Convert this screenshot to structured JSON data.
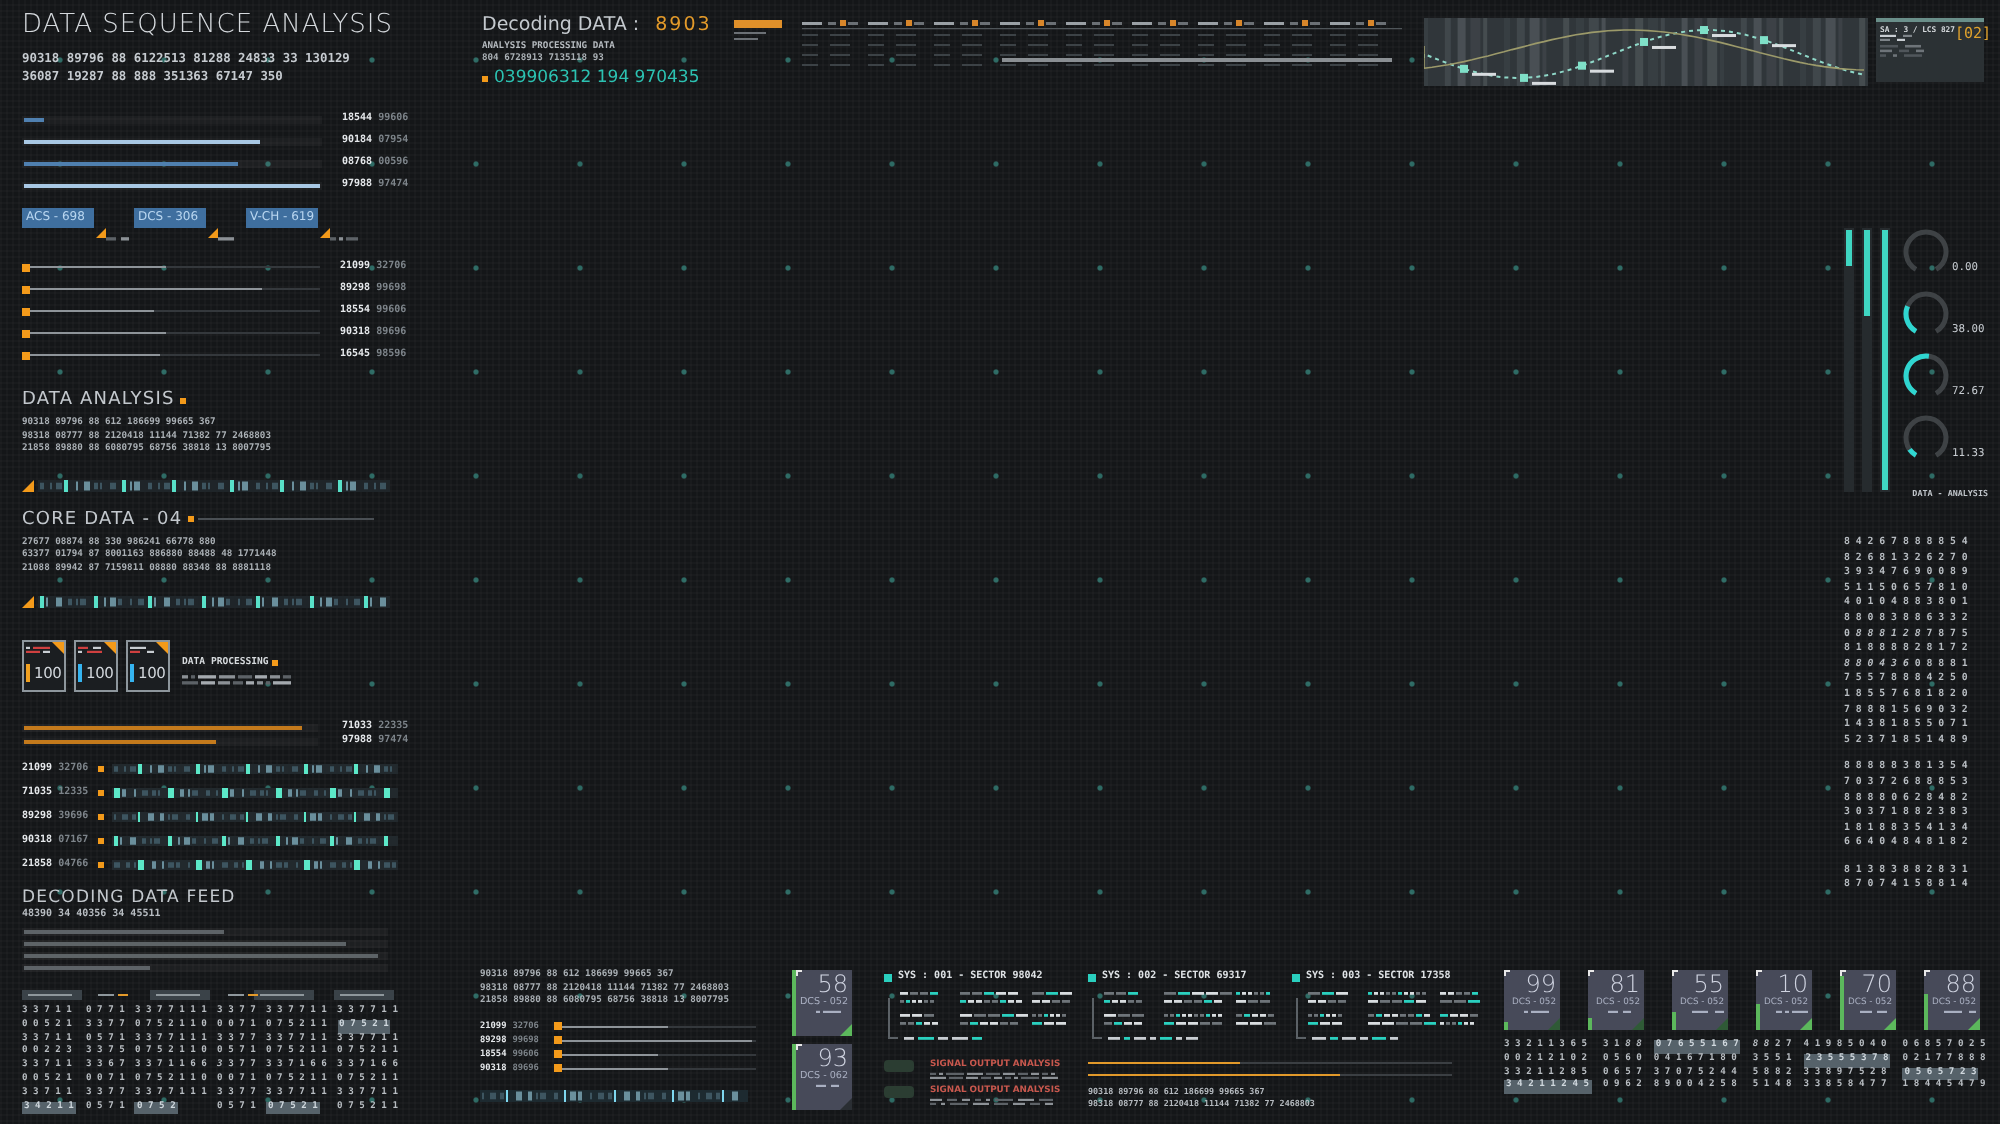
{
  "title": "DATA SEQUENCE ANALYSIS",
  "header_codes": [
    "90318 89796 88 6122513 81288 24833 33 130129",
    "36087 19287 88 888 351363 67147 350"
  ],
  "level_bars": [
    {
      "level": 0.07,
      "color": "#4f80b0",
      "value": "18544",
      "code": "99606"
    },
    {
      "level": 0.8,
      "color": "#a8c8e4",
      "value": "90184",
      "code": "07954"
    },
    {
      "level": 0.72,
      "color": "#4f80b0",
      "value": "08768",
      "code": "00596"
    },
    {
      "level": 1,
      "color": "#a8c8e4",
      "value": "97988",
      "code": "97474"
    }
  ],
  "tags": [
    "ACS - 698",
    "DCS - 306",
    "V-CH - 619"
  ],
  "sliders": [
    {
      "level": 0.47,
      "value": "21099",
      "code": "32706"
    },
    {
      "level": 0.8,
      "value": "89298",
      "code": "99698"
    },
    {
      "level": 0.43,
      "value": "18554",
      "code": "99606"
    },
    {
      "level": 0.47,
      "value": "90318",
      "code": "89696"
    },
    {
      "level": 0.45,
      "value": "16545",
      "code": "98596"
    }
  ],
  "data_analysis": {
    "title": "DATA ANALYSIS",
    "lines": [
      "90318 89796 88 612 186699 99665 367",
      "98318 08777 88 2120418 11144 71382 77 2468803",
      "21858 89880 88 6080795 68756 38818 13 8007795"
    ]
  },
  "core_data": {
    "title": "CORE DATA - 04",
    "lines": [
      "27677 08874 88 330 986241 66778 880",
      "63377 01794 87 8001163 886880 88488 48 1771448",
      "21088 89942 87 7159811 08880 88348 88 8881118"
    ]
  },
  "meters": [
    {
      "value": "100",
      "color": "#f0a020"
    },
    {
      "value": "100",
      "color": "#35b4f0"
    },
    {
      "value": "100",
      "color": "#35b4f0"
    }
  ],
  "processing": {
    "title": "DATA PROCESSING"
  },
  "orange_bars": [
    {
      "level": 0.95,
      "value": "71033",
      "code": "22335"
    },
    {
      "level": 0.66,
      "value": "97988",
      "code": "97474"
    }
  ],
  "signal_rows": [
    {
      "value": "21099",
      "code": "32706"
    },
    {
      "value": "71035",
      "code": "12335"
    },
    {
      "value": "89298",
      "code": "39696"
    },
    {
      "value": "90318",
      "code": "07167"
    },
    {
      "value": "21858",
      "code": "04766"
    }
  ],
  "feed": {
    "title": "DECODING DATA FEED",
    "code": "48390 34 40356 34 45511",
    "bars": [
      {
        "level": 0.55
      },
      {
        "level": 0.89
      },
      {
        "level": 0.98
      },
      {
        "level": 0.35
      }
    ]
  },
  "feed_grid": [
    {
      "rows": [
        {
          "text": "3 3 7 1 1",
          "framed": false
        },
        {
          "text": "0 0 5 2 1",
          "framed": false
        },
        {
          "text": "3 3 7 1 1",
          "framed": false
        },
        {
          "text": "0 0 2 2 3",
          "framed": false
        },
        {
          "text": "3 3 7 1 1",
          "framed": false
        },
        {
          "text": "0 0 5 2 1",
          "framed": false
        },
        {
          "text": "3 3 7 1 1",
          "framed": false
        },
        {
          "text": "3 4 2 1 1",
          "framed": true
        }
      ]
    },
    {
      "rows": [
        {
          "text": "0 7 7 1",
          "framed": false
        },
        {
          "text": "3 3 7 7",
          "framed": false
        },
        {
          "text": "0 5 7 1",
          "framed": false
        },
        {
          "text": "3 3 7 5",
          "framed": false
        },
        {
          "text": "3 3 6 7",
          "framed": false
        },
        {
          "text": "0 0 7 1",
          "framed": false
        },
        {
          "text": "3 3 7 7",
          "framed": false
        },
        {
          "text": "0 5 7 1",
          "framed": false
        }
      ]
    },
    {
      "rows": [
        {
          "text": "3 3 7 7 1 1 1",
          "framed": false
        },
        {
          "text": "0 7 5 2 1 1 0",
          "framed": false
        },
        {
          "text": "3 3 7 7 1 1 1",
          "framed": false
        },
        {
          "text": "0 7 5 2 1 1 0",
          "framed": false
        },
        {
          "text": "3 3 7 1 1 6 6",
          "framed": false
        },
        {
          "text": "0 7 5 2 1 1 0",
          "framed": false
        },
        {
          "text": "3 3 7 7 1 1 1",
          "framed": false
        },
        {
          "text": "0 7 5 2",
          "framed": true
        }
      ]
    },
    {
      "rows": [
        {
          "text": "3 3 7 7",
          "framed": false
        },
        {
          "text": "0 0 7 1",
          "framed": false
        },
        {
          "text": "3 3 7 7",
          "framed": false
        },
        {
          "text": "0 5 7 1",
          "framed": false
        },
        {
          "text": "*3* 3 7 7",
          "framed": false
        },
        {
          "text": "0 0 7 1",
          "framed": false
        },
        {
          "text": "3 3 7 7",
          "framed": false
        },
        {
          "text": "0 5 7 1",
          "framed": false
        }
      ]
    },
    {
      "rows": [
        {
          "text": "3 3 7 7 1 1",
          "framed": false
        },
        {
          "text": "0 7 5 2 1 1",
          "framed": false
        },
        {
          "text": "3 3 7 7 1 1",
          "framed": false
        },
        {
          "text": "0 7 5 2 1 1",
          "framed": false
        },
        {
          "text": "3 3 7 1 6 6",
          "framed": false
        },
        {
          "text": "0 7 5 2 1 1",
          "framed": false
        },
        {
          "text": "3 3 7 7 1 1",
          "framed": false
        },
        {
          "text": "0 7 5 2 1",
          "framed": true
        }
      ]
    },
    {
      "rows": [
        {
          "text": "3 3 7 7 1 1",
          "framed": false
        },
        {
          "text": "0 7 5 2 1",
          "framed": true
        },
        {
          "text": "3 3 7 7 1 1",
          "framed": false
        },
        {
          "text": "0 7 5 2 1 1",
          "framed": false
        },
        {
          "text": "3 3 7 1 6 6",
          "framed": false
        },
        {
          "text": "0 7 5 2 1 1",
          "framed": false
        },
        {
          "text": "3 3 7 7 1 1",
          "framed": false
        },
        {
          "text": "0 7 5 2 1 1",
          "framed": false
        }
      ]
    }
  ],
  "decoding": {
    "label": "Decoding DATA :",
    "value": "8903",
    "subtitle": "ANALYSIS PROCESSING DATA",
    "code": "804 6728913 7135118 93",
    "stream": "039906312 194 970435"
  },
  "sa_panel": {
    "caption": "SA : 3 / LCS 827",
    "index": "[02]"
  },
  "vertical_bars": [
    {
      "level": 0.14
    },
    {
      "level": 0.33
    },
    {
      "level": 1
    }
  ],
  "gauges": [
    {
      "reading": "0.00"
    },
    {
      "reading": "38.00",
      "level": 0.23
    },
    {
      "reading": "72.67",
      "level": 0.44
    },
    {
      "reading": "11.33",
      "level": 0.07
    }
  ],
  "gauge_caption": "DATA - ANALYSIS",
  "matrix": [
    {
      "rows": [
        "8 4 2 6 7 **8 8 8 8** 5 4",
        "8 2 6 8 1 3 2 6 2 7 0",
        "3 9 3 4 7 6 9 0 0 8 9",
        "5 1 1 5 0 6 5 **7 8** 1 0",
        "4 0 1 0 4 8 8 3 8 0 1",
        "8 8 0 **8 3** 8 8 6 3 3 2",
        "0 *8 8 8 1 2 8* 7 8 7 5",
        "8 1 **8 8 8 8** 2 8 1 7 2",
        "*8 8 0 4 3 6* 0 **8 8** 8 1",
        "7 5 5 7 8 8 8 4 2 5 0",
        "1 **8 5 5** 7 6 8 1 8 2 0",
        "7 8 8 8 1 5 6 9 0 3 2",
        "1 4 3 8 1 8 5 5 0 **7 1**",
        "5 2 3 7 1 8 5 1 4 8 9"
      ]
    },
    {
      "rows": [
        "8 8 **8 8 8** 3 8 1 3 5 4",
        "7 0 3 7 2 6 **8 8 8** 5 3",
        "8 **8 8 8** 0 6 2 8 4 8 2",
        "3 0 3 7 1 8 8 2 3 8 3",
        "1 8 1 8 8 3 5 **4 1** 3 4",
        "6 6 4 0 4 8 4 8 1 8 2"
      ]
    },
    {
      "rows": [
        "8 1 3 **8 3 8 8** 2 8 3 1",
        "8 7 0 7 4 1 5 **8 8** 1 4"
      ]
    }
  ],
  "bottom": {
    "lines": [
      "90318 89796 88 612 186699 99665 367",
      "98318 08777 88 2120418 11144 71382 77 2468803",
      "21858 89880 88 6080795 68756 38818 13 8007795"
    ],
    "sliders": [
      {
        "level": 0.55,
        "value": "21099",
        "code": "32706"
      },
      {
        "level": 0.98,
        "value": "89298",
        "code": "99698"
      },
      {
        "level": 0.5,
        "value": "18554",
        "code": "99606"
      },
      {
        "level": 0.55,
        "value": "90318",
        "code": "89696"
      }
    ]
  },
  "tall_cards": [
    {
      "value": "58",
      "code": "DCS - 052",
      "color": "#5cb85c"
    },
    {
      "value": "93",
      "code": "DCS - 062",
      "color": "#2a2e33"
    }
  ],
  "sectors": [
    {
      "title": "SYS : 001 - SECTOR 98042"
    },
    {
      "title": "SYS : 002 - SECTOR 69317"
    },
    {
      "title": "SYS : 003 - SECTOR 17358"
    }
  ],
  "signal_notes": [
    {
      "title": "SIGNAL OUTPUT ANALYSIS"
    },
    {
      "title": "SIGNAL OUTPUT ANALYSIS"
    }
  ],
  "progress": [
    {
      "level": 0.42
    },
    {
      "level": 0.69
    }
  ],
  "progress_lines": [
    "90318 89796 88 612 186699 99665 367",
    "98318 08777 88 2120418 11144 71382 77 2468803"
  ],
  "small_cards": [
    {
      "value": "99",
      "code": "DCS - 052",
      "level": 0.12,
      "color": "#2f5a36"
    },
    {
      "value": "81",
      "code": "DCS - 052",
      "level": 0.2,
      "color": "#2f5a36"
    },
    {
      "value": "55",
      "code": "DCS - 052",
      "level": 0.3,
      "color": "#2f5a36"
    },
    {
      "value": "10",
      "code": "DCS - 052",
      "level": 0.45,
      "color": "#5cb85c"
    },
    {
      "value": "70",
      "code": "DCS - 052",
      "level": 0.9,
      "color": "#5cb85c"
    },
    {
      "value": "88",
      "code": "DCS - 052",
      "level": 0.6,
      "color": "#5cb85c"
    }
  ],
  "small_grid": [
    {
      "rows": [
        {
          "text": "3 3 2 1 1 3 6 5",
          "framed": false
        },
        {
          "text": "0 0 2 1 2 1 0 2",
          "framed": false
        },
        {
          "text": "3 3 2 1 1 2 8 5",
          "framed": false
        },
        {
          "text": "3 4 2 1 1 2 4 5",
          "framed": true
        }
      ]
    },
    {
      "rows": [
        {
          "text": "3 1 *8 8*",
          "framed": false
        },
        {
          "text": "0 5 6 0",
          "framed": false
        },
        {
          "text": "0 6 5 7",
          "framed": false
        },
        {
          "text": "0 9 6 2",
          "framed": false
        }
      ]
    },
    {
      "rows": [
        {
          "text": "0 7 6 5 5 1 6 7",
          "framed": true
        },
        {
          "text": "0 4 1 6 7 1 8 0",
          "framed": false
        },
        {
          "text": "3 7 0 7 5 2 4 4",
          "framed": false
        },
        {
          "text": "8 9 0 0 4 2 5 8",
          "framed": false
        }
      ]
    },
    {
      "rows": [
        {
          "text": "*8 8* 2 7",
          "framed": false
        },
        {
          "text": "3 5 5 1",
          "framed": false
        },
        {
          "text": "5 8 8 2",
          "framed": false
        },
        {
          "text": "5 1 4 8",
          "framed": false
        }
      ]
    },
    {
      "rows": [
        {
          "text": "4 1 9 8 5 0 4 0",
          "framed": false
        },
        {
          "text": "2 3 5 5 5 3 7 8",
          "framed": true
        },
        {
          "text": "3 3 8 9 7 5 2 8",
          "framed": false
        },
        {
          "text": "3 3 8 5 8 4 7 7",
          "framed": false
        }
      ]
    },
    {
      "rows": [
        {
          "text": "0 6 8 5 7 0 2 5",
          "framed": false
        },
        {
          "text": "0 2 1 7 7 8 8 8",
          "framed": false
        },
        {
          "text": "0 5 6 5 7 2 3",
          "framed": true
        },
        {
          "text": "1 8 4 4 5 4 7 9",
          "framed": false
        }
      ]
    }
  ]
}
